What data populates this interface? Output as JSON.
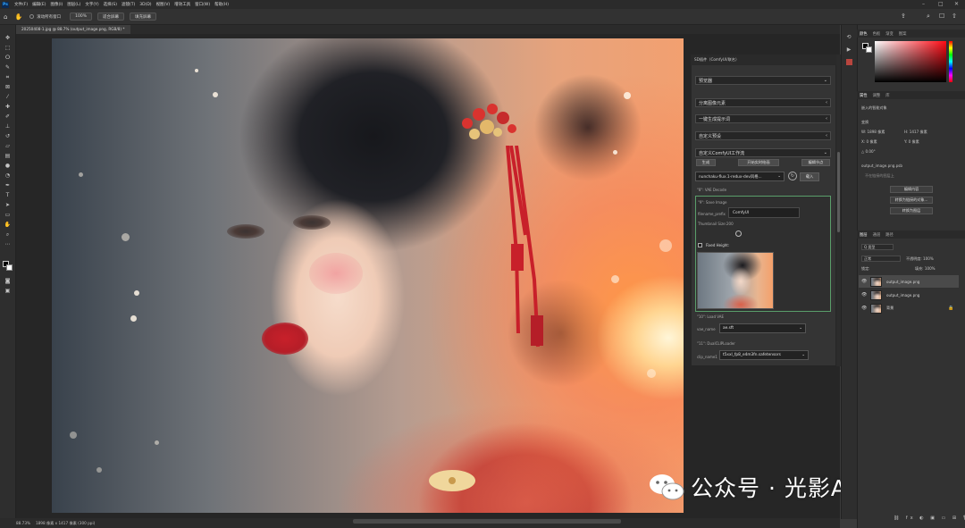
{
  "menubar": {
    "logo": "Ps",
    "items": [
      "文件(F)",
      "编辑(E)",
      "图像(I)",
      "图层(L)",
      "文字(Y)",
      "选择(S)",
      "滤镜(T)",
      "3D(D)",
      "视图(V)",
      "增效工具",
      "窗口(W)",
      "帮助(H)"
    ]
  },
  "options": {
    "scroll_all_label": "滚动所有窗口",
    "zoom_value": "100%",
    "fit_screen": "适合屏幕",
    "fill_screen": "填充屏幕"
  },
  "document": {
    "tab_title": "20250408-1.jpg @ 88.7% (output_image.png, RGB/8) *"
  },
  "status": {
    "zoom": "88.73%",
    "size": "1898 像素 x 1417 像素 (300 ppi)"
  },
  "watermark": {
    "text": "公众号 · 光影AI艺术"
  },
  "plugin": {
    "header": "SD插件（ComfyUI/联名）",
    "sections": {
      "preview": "预览器",
      "separate": "分离图像元素",
      "prompt": "一键生成提示词",
      "preset": "自定义预设",
      "workflow": "自定义ComfyUI工作流"
    },
    "buttons": {
      "generate": "生成",
      "realtime": "开始实时绘画",
      "edit_node": "编辑节点",
      "load": "载入"
    },
    "model_select": "nunchaku-flux.1-redux-dev风格...",
    "vae_decode_label": "\"8\": VAE Decode",
    "save_image_label": "\"9\": Save Image",
    "filename_prefix_label": "filename_prefix",
    "filename_prefix_value": "ComfyUI",
    "thumbnail_label": "Thumbnail Size:200",
    "fixed_height_label": "Fixed Height:",
    "load_vae_label": "\"10\": Load VAE",
    "vae_name_label": "vae_name",
    "vae_value": "ae.sft",
    "dualclip_label": "\"11\": DualCLIPLoader",
    "clip_name_label": "clip_name1",
    "clip_value": "t5xxl_fp8_e4m3fn.safetensors"
  },
  "right_panel": {
    "color_tabs": [
      "颜色",
      "色板",
      "渐变",
      "图案"
    ],
    "props_tabs": [
      "属性",
      "调整",
      "库"
    ],
    "smart_object": "嵌入的智能对象",
    "transform": "变换",
    "w": "W: 1898 像素",
    "h": "H: 1417 像素",
    "x": "X: 0 像素",
    "y": "Y: 0 像素",
    "angle": "△ 0.00°",
    "filename": "output_image.png.psb",
    "link_hint": "不在链接的图层上",
    "edit_content": "编辑内容",
    "convert_linked": "转换为链接的对象...",
    "convert_layers": "转换为图层",
    "layers_tabs": [
      "图层",
      "通道",
      "路径"
    ],
    "kind": "Q 类型",
    "blend_mode": "正常",
    "opacity": "不透明度: 100%",
    "lock": "锁定:",
    "fill": "填充: 100%",
    "layers": [
      {
        "name": "output_image.png",
        "selected": true
      },
      {
        "name": "output_image.png",
        "selected": false
      },
      {
        "name": "背景",
        "selected": false
      }
    ]
  },
  "colors": {
    "accent_green": "#5a9e6a",
    "fg": "#000000",
    "bg": "#ffffff"
  }
}
